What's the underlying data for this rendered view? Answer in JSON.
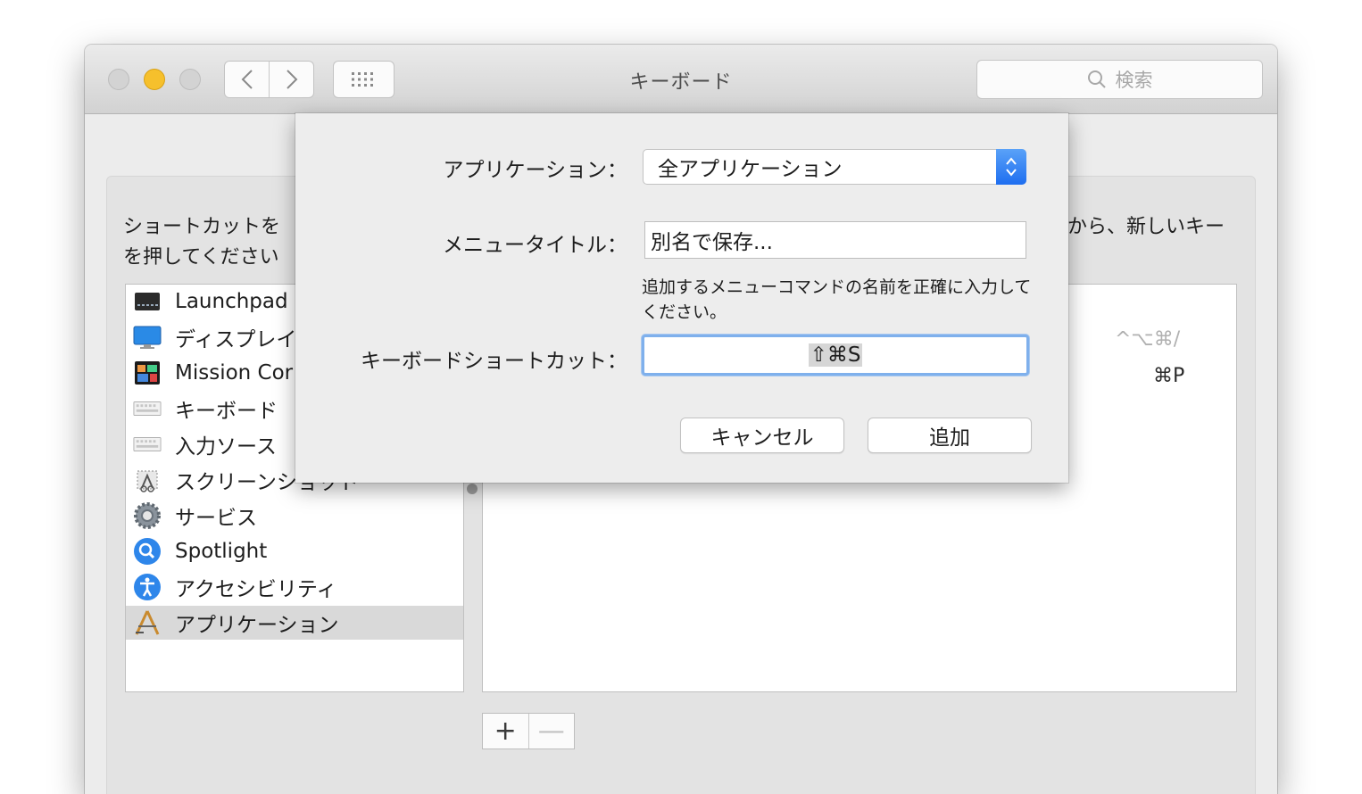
{
  "window": {
    "title": "キーボード",
    "search_placeholder": "検索"
  },
  "instruction": {
    "left_line1": "ショートカットを",
    "left_line2": "を押してください",
    "right_line1": "から、新しいキー"
  },
  "sidebar": {
    "items": [
      {
        "label": "Launchpad",
        "icon": "launchpad-icon"
      },
      {
        "label": "ディスプレイ",
        "icon": "display-icon"
      },
      {
        "label": "Mission Cor",
        "icon": "mission-control-icon"
      },
      {
        "label": "キーボード",
        "icon": "keyboard-icon"
      },
      {
        "label": "入力ソース",
        "icon": "keyboard-icon"
      },
      {
        "label": "スクリーンショット",
        "icon": "screenshot-icon"
      },
      {
        "label": "サービス",
        "icon": "gear-icon"
      },
      {
        "label": "Spotlight",
        "icon": "spotlight-icon"
      },
      {
        "label": "アクセシビリティ",
        "icon": "accessibility-icon"
      },
      {
        "label": "アプリケーション",
        "icon": "applications-icon",
        "selected": true
      }
    ]
  },
  "detail": {
    "shortcut_1": "^⌥⌘/",
    "shortcut_2": "⌘P"
  },
  "buttons": {
    "add": "+",
    "remove": "—"
  },
  "sheet": {
    "application_label": "アプリケーション：",
    "application_value": "全アプリケーション",
    "menu_title_label": "メニュータイトル：",
    "menu_title_value": "別名で保存...",
    "hint": "追加するメニューコマンドの名前を正確に入力してください。",
    "shortcut_label": "キーボードショートカット：",
    "shortcut_value": "⇧⌘S",
    "cancel_label": "キャンセル",
    "add_label": "追加"
  },
  "colors": {
    "accent": "#1e6ef0",
    "focus_ring": "#7fb0ec",
    "minimize": "#f6c02c"
  }
}
